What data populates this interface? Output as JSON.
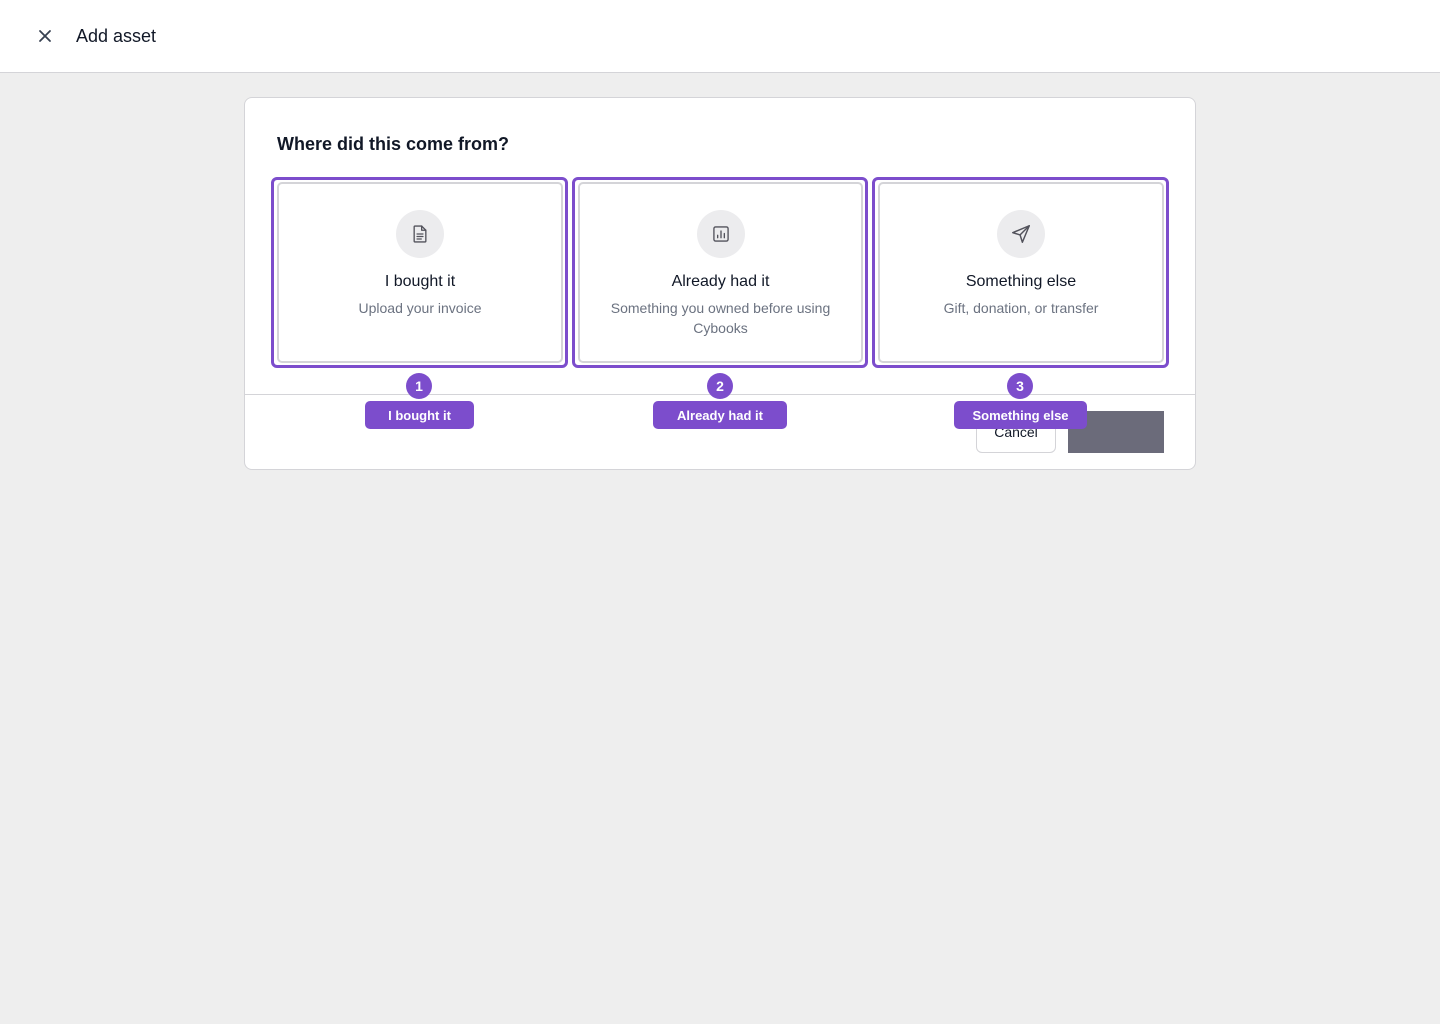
{
  "header": {
    "title": "Add asset",
    "close_icon": "close-icon"
  },
  "modal": {
    "question": "Where did this come from?",
    "options": [
      {
        "title": "I bought it",
        "subtitle": "Upload your invoice",
        "icon": "document-icon"
      },
      {
        "title": "Already had it",
        "subtitle": "Something you owned before using Cybooks",
        "icon": "bar-chart-icon"
      },
      {
        "title": "Something else",
        "subtitle": "Gift, donation, or transfer",
        "icon": "send-icon"
      }
    ],
    "cancel_label": "Cancel",
    "primary_label": ""
  },
  "annotations": [
    {
      "number": "1",
      "label": "I bought it"
    },
    {
      "number": "2",
      "label": "Already had it"
    },
    {
      "number": "3",
      "label": "Something else"
    }
  ],
  "colors": {
    "accent": "#7c4dcc",
    "background": "#eeeeee",
    "primary_button": "#6b6b7a"
  }
}
